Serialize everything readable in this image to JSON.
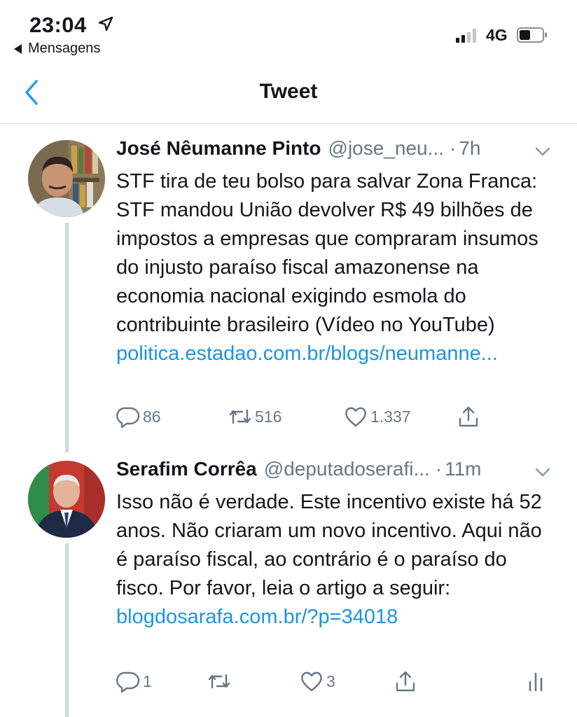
{
  "status_bar": {
    "time": "23:04",
    "back_app_label": "Mensagens",
    "network": "4G",
    "location_icon": "location-arrow-icon",
    "signal_icon": "cellular-signal-icon",
    "battery_icon": "battery-icon"
  },
  "nav": {
    "title": "Tweet",
    "back_icon": "chevron-left-icon",
    "accent_color": "#1da1f2"
  },
  "tweets": [
    {
      "author_name": "José Nêumanne Pinto",
      "handle": "@jose_neu...",
      "separator": "·",
      "time": "7h",
      "text": "STF tira de teu bolso para salvar Zona Franca: STF mandou União devolver R$ 49 bilhões de impostos a empresas que compraram insumos do injusto paraíso fiscal amazonense na economia nacional exigindo esmola do contribuinte brasileiro (Vídeo no YouTube)",
      "link": "politica.estadao.com.br/blogs/neumanne...",
      "replies": "86",
      "retweets": "516",
      "likes": "1.337"
    },
    {
      "author_name": "Serafim Corrêa",
      "handle": "@deputadoserafi...",
      "separator": "·",
      "time": "11m",
      "text": "Isso não é verdade. Este incentivo existe há 52 anos. Não criaram um novo incentivo. Aqui não é paraíso fiscal, ao contrário é o paraíso do fisco. Por favor, leia o artigo a seguir:",
      "link": "blogdosarafa.com.br/?p=34018",
      "replies": "1",
      "retweets": "",
      "likes": "3"
    }
  ],
  "colors": {
    "link": "#1b95e0",
    "secondary_text": "#657786",
    "thread_line": "#ccd6dd"
  }
}
